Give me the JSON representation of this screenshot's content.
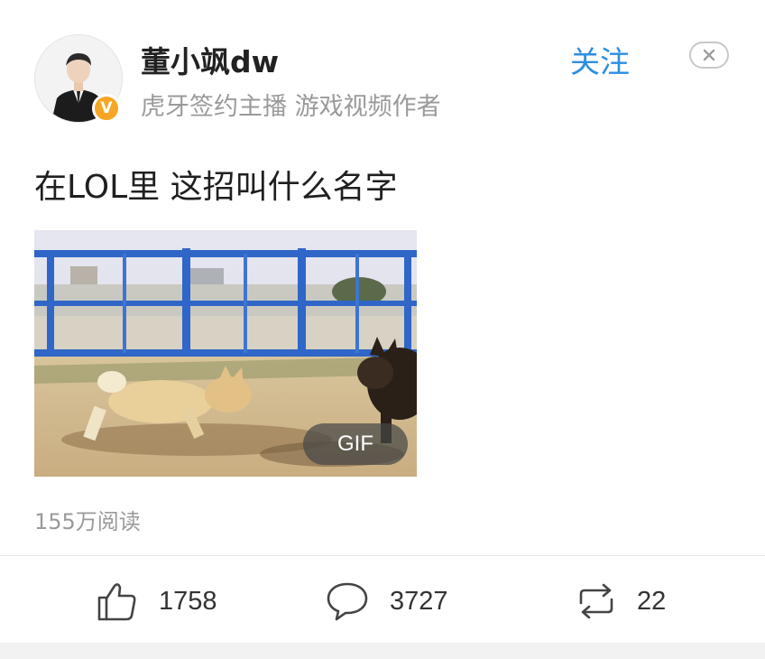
{
  "user": {
    "name": "董小飒dw",
    "description": "虎牙签约主播 游戏视频作者",
    "follow_label": "关注",
    "verified_badge": "V"
  },
  "post": {
    "text": "在LOL里 这招叫什么名字",
    "media_badge": "GIF",
    "reads": "155万阅读"
  },
  "actions": {
    "likes": "1758",
    "comments": "3727",
    "reposts": "22"
  },
  "icons": {
    "close": "close-icon",
    "like": "thumbs-up-icon",
    "comment": "comment-bubble-icon",
    "repost": "repost-icon"
  },
  "colors": {
    "accent": "#2d8ee0",
    "verified": "#f5a623",
    "muted_text": "#9a9a9a"
  }
}
